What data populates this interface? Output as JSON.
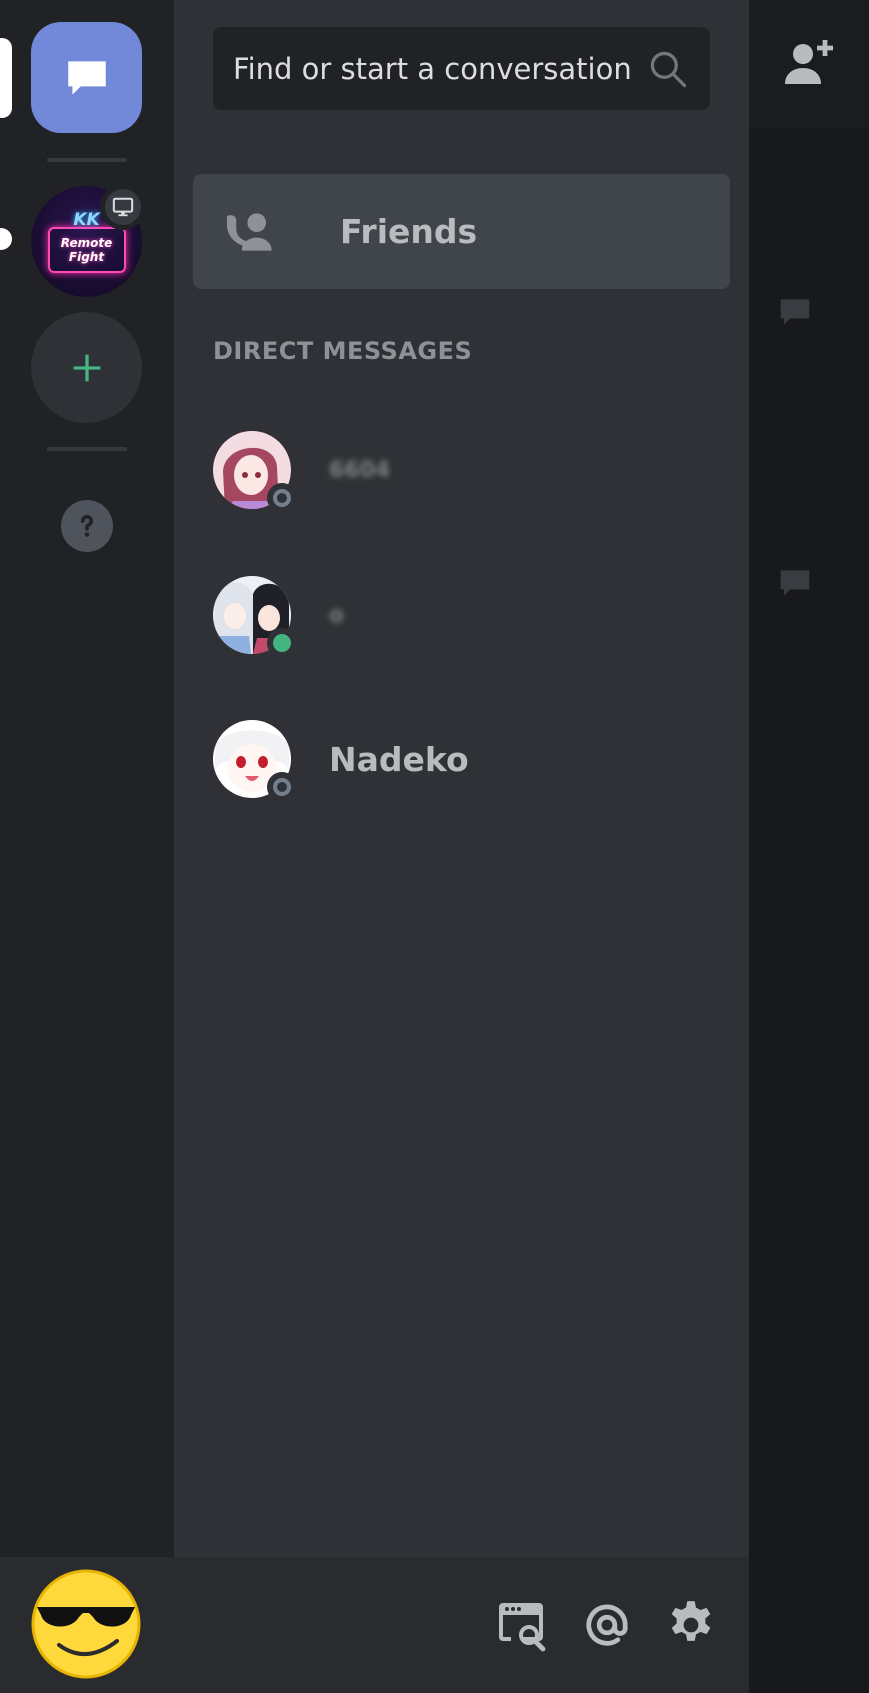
{
  "search": {
    "placeholder": "Find or start a conversation"
  },
  "friends": {
    "label": "Friends"
  },
  "direct_messages": {
    "header": "DIRECT MESSAGES",
    "items": [
      {
        "name": "6604",
        "status": "offline",
        "blurred": true
      },
      {
        "name": "o",
        "status": "online",
        "blurred": true
      },
      {
        "name": "Nadeko",
        "status": "offline",
        "blurred": false
      }
    ]
  },
  "rail": {
    "server": {
      "logo": "KK",
      "line1": "Remote",
      "line2": "Fight"
    }
  },
  "colors": {
    "blurple": "#7289da",
    "online": "#43b581",
    "offline": "#747f8d",
    "add_green": "#43b581"
  },
  "icons": [
    "chat-bubble-icon",
    "screen-share-icon",
    "plus-icon",
    "question-icon",
    "search-icon",
    "friends-icon",
    "add-friend-icon",
    "discovery-icon",
    "mention-icon",
    "gear-icon"
  ]
}
